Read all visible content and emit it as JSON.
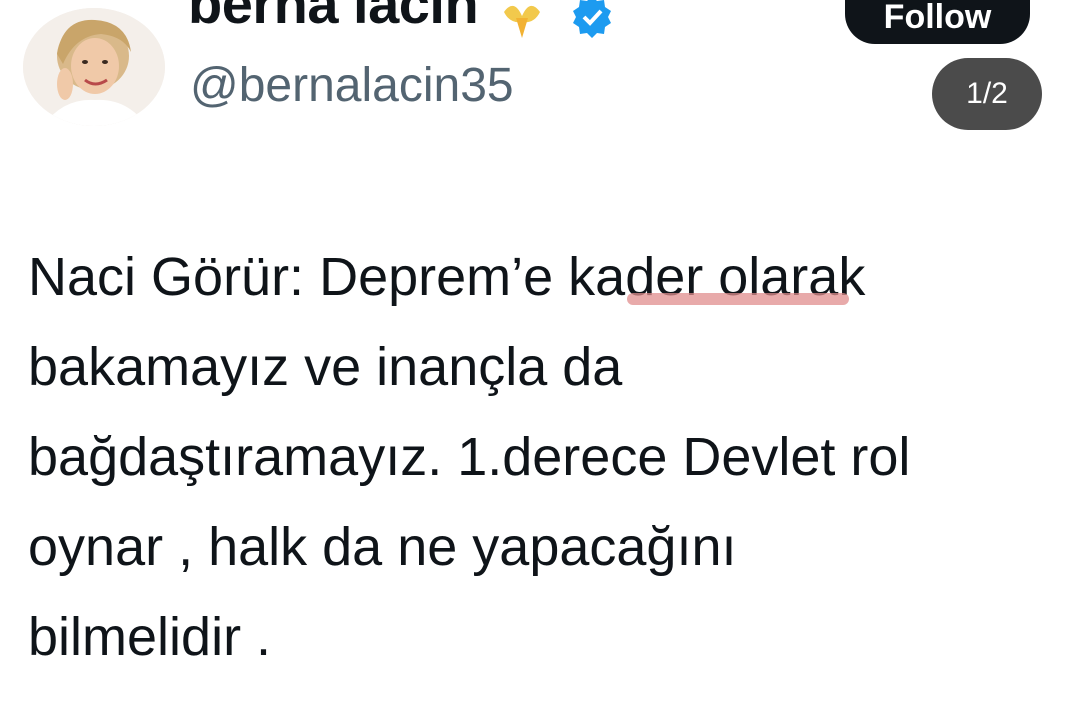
{
  "profile": {
    "display_name": "berna lacin",
    "handle": "@bernalacin35",
    "avatar_icon": "avatar-photo",
    "name_icons": [
      "angel-emoji-icon",
      "verified-badge-icon"
    ]
  },
  "header": {
    "follow_label": "Follow"
  },
  "media": {
    "page_indicator": "1/2"
  },
  "tweet": {
    "lines": [
      "Naci Görür: Deprem’e kader olarak",
      "bakamayız ve inançla da",
      "bağdaştıramayız. 1.derece Devlet rol",
      "oynar , halk da ne yapacağını",
      "bilmelidir ."
    ],
    "highlighted_word": "kader"
  },
  "colors": {
    "text": "#0f1419",
    "handle": "#536471",
    "verified": "#1d9bf0",
    "underline": "#e08e8e",
    "badge": "#4b4b4b"
  }
}
